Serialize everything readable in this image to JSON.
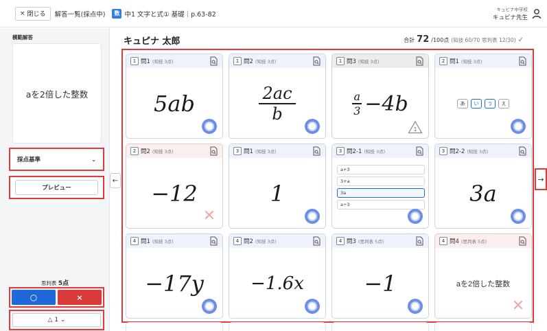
{
  "topbar": {
    "close_label": "閉じる",
    "close_x": "×",
    "list_label": "解答一覧(採点中)",
    "subject_badge": "数",
    "unit_title": "中1 文字と式① 基礎｜p.63-82",
    "school": "キュビナ中学校",
    "teacher": "キュビナ先生"
  },
  "left": {
    "model_label": "模範解答",
    "model_answer": "aを2倍した整数",
    "criteria_label": "採点基準",
    "criteria_chevron": "⌄",
    "preview_label": "プレビュー",
    "score_caption": "思判表",
    "score_value": "5点",
    "correct_label": "○",
    "wrong_label": "×",
    "partial_label": "△ 1 ⌄"
  },
  "main": {
    "student_name": "キュピナ 太郎",
    "total_label": "合計",
    "total_score": "72",
    "total_suffix": "/100点",
    "breakdown_1": "(知技 60/70",
    "breakdown_2": "思判表 12/30)",
    "check": "✓"
  },
  "cards": [
    {
      "num": "1",
      "title": "問1",
      "pts": "(知技 3点)",
      "type": "hand",
      "answer": "5ab",
      "mark": "circle",
      "head": "blue"
    },
    {
      "num": "1",
      "title": "問2",
      "pts": "(知技 3点)",
      "type": "fraction",
      "answer_num": "2ac",
      "answer_den": "b",
      "mark": "circle",
      "head": "blue"
    },
    {
      "num": "1",
      "title": "問3",
      "pts": "(知技 3点)",
      "type": "fraction_expr",
      "answer_num": "a",
      "answer_den": "3",
      "answer_rest": "−4b",
      "mark": "triangle",
      "head": "gray"
    },
    {
      "num": "2",
      "title": "問1",
      "pts": "(知技 3点)",
      "type": "choices",
      "choices": [
        "あ",
        "い",
        "う",
        "え"
      ],
      "selected": [
        1,
        2
      ],
      "mark": "circle",
      "head": "blue"
    },
    {
      "num": "2",
      "title": "問2",
      "pts": "(知技 3点)",
      "type": "hand",
      "answer": "−12",
      "mark": "cross",
      "head": "pink"
    },
    {
      "num": "3",
      "title": "問1",
      "pts": "(知技 3点)",
      "type": "hand",
      "answer": "1",
      "mark": "circle",
      "head": "blue"
    },
    {
      "num": "3",
      "title": "問2-1",
      "pts": "(知技 3点)",
      "type": "options",
      "options": [
        "a+3",
        "3+a",
        "3a",
        "a÷3"
      ],
      "selected": 2,
      "mark": "circle",
      "head": "blue"
    },
    {
      "num": "3",
      "title": "問2-2",
      "pts": "(知技 3点)",
      "type": "hand",
      "answer": "3a",
      "mark": "circle",
      "head": "blue"
    },
    {
      "num": "4",
      "title": "問1",
      "pts": "(知技 3点)",
      "type": "hand",
      "answer": "−17y",
      "mark": "circle",
      "head": "blue"
    },
    {
      "num": "4",
      "title": "問2",
      "pts": "(知技 3点)",
      "type": "hand",
      "answer": "−1.6x",
      "mark": "circle",
      "head": "blue"
    },
    {
      "num": "4",
      "title": "問3",
      "pts": "(思判表 5点)",
      "type": "hand",
      "answer": "−1",
      "mark": "circle",
      "head": "blue"
    },
    {
      "num": "4",
      "title": "問4",
      "pts": "(思判表 5点)",
      "type": "text",
      "answer": "aを2倍した整数",
      "mark": "cross",
      "head": "pink"
    }
  ],
  "nav": {
    "prev": "←",
    "next": "→"
  },
  "colors": {
    "accent_blue": "#1f68d8",
    "alert_red": "#e23a3a",
    "correct_blue": "#6c8ee6",
    "wrong_pink": "#f3a8a8"
  }
}
